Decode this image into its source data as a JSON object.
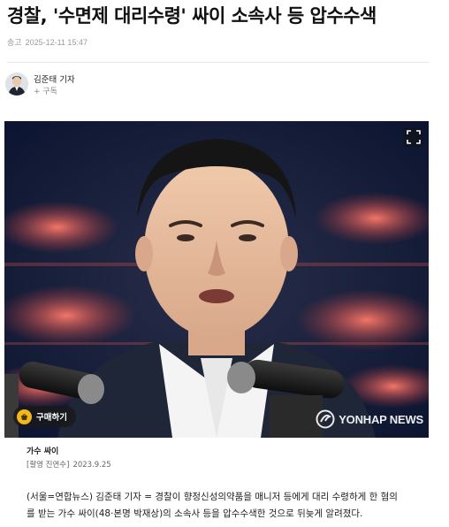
{
  "article": {
    "headline": "경찰, '수면제 대리수령' 싸이 소속사 등 압수수색",
    "sent_label": "송고",
    "sent_time": "2025-12-11 15:47"
  },
  "author": {
    "name": "김준태 기자",
    "subscribe_label": "+ 구독"
  },
  "photo": {
    "buy_label": "구매하기",
    "watermark": "YONHAP NEWS",
    "caption": "가수 싸이",
    "credit_source": "[촬영 진연수]",
    "credit_date": "2023.9.25"
  },
  "body": {
    "line1": "(서울=연합뉴스) 김준태 기자 = 경찰이 향정신성의약품을 매니저 등에게 대리 수령하게 한 혐의",
    "line2": "를 받는 가수 싸이(48·본명 박재상)의 소속사 등을 압수수색한 것으로 뒤늦게 알려졌다."
  },
  "colors": {
    "coin": "#f1b81c",
    "photo_background": "#0f1a33",
    "stage_lights": "#b3343a"
  }
}
